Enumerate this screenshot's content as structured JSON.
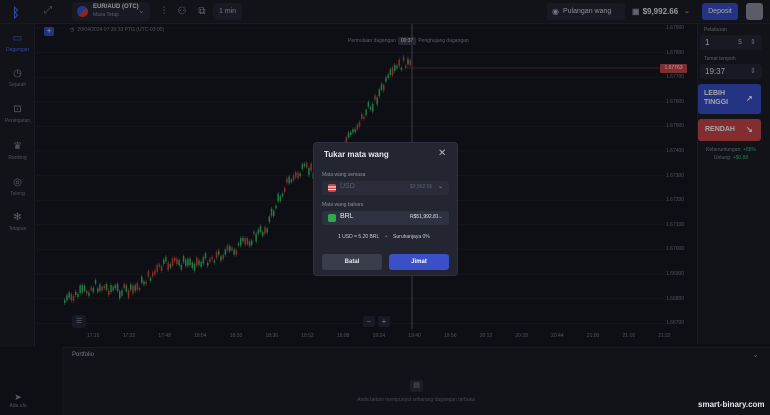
{
  "topbar": {
    "asset_name": "EUR/AUD (OTC)",
    "asset_sub": "Masa Tetap",
    "timeframe": "1 min",
    "switch_account": "Pulangan wang tunai",
    "balance": "$9,992.66",
    "deposit": "Deposit"
  },
  "sidebar": {
    "items": [
      {
        "label": "Dagangan",
        "icon": "trading-icon"
      },
      {
        "label": "Sejarah",
        "icon": "history-icon"
      },
      {
        "label": "Peningatan",
        "icon": "gift-icon"
      },
      {
        "label": "Ranking",
        "icon": "trophy-icon"
      },
      {
        "label": "Tolong",
        "icon": "help-icon"
      },
      {
        "label": "Tetapan",
        "icon": "settings-icon"
      }
    ],
    "chat": "Ada ulu"
  },
  "chart": {
    "datetime": "20/04/2024 07:35:33 PTG (UTC-03:00)",
    "start_text": "Permulaan dagangan",
    "start_tag": "00:37",
    "end_text": "Penghujung dagangan",
    "current_price": "1.67763",
    "price_labels": [
      "1.67900",
      "1.67800",
      "1.67700",
      "1.67600",
      "1.67500",
      "1.67400",
      "1.67300",
      "1.67200",
      "1.67100",
      "1.67000",
      "1.66900",
      "1.66800",
      "1.66700"
    ],
    "time_labels": [
      "17:16",
      "17:32",
      "17:48",
      "18:04",
      "18:20",
      "18:36",
      "18:52",
      "19:08",
      "19:24",
      "19:40",
      "19:56",
      "20:12",
      "20:28",
      "20:44",
      "21:00",
      "21:16",
      "21:32"
    ],
    "zoom_minus": "−",
    "zoom_plus": "+"
  },
  "right_panel": {
    "amount_label": "Pelaburan",
    "amount_value": "1",
    "expiry_label": "Tamat tempoh",
    "expiry_value": "19:37",
    "up_line1": "LEBIH",
    "up_line2": "TINGGI",
    "down": "RENDAH",
    "profit_label": "Keberuntungan: ",
    "profit_pct": "+88%",
    "profit_value_label": "Untung: ",
    "profit_value": "+$0.88"
  },
  "portfolio": {
    "title": "Portfolio",
    "empty_text": "Anda belum mempunyai sebarang dagangan terbuka"
  },
  "modal": {
    "title": "Tukar mata wang",
    "current_label": "Mata wang semasa",
    "current_code": "USD",
    "current_amount": "$9,992.66",
    "new_label": "Mata wang baharu",
    "new_code": "BRL",
    "new_amount": "R$51,992.81",
    "rate": "1 USD = 5.20 BRL",
    "commission": "Suruhanjaya 0%",
    "cancel": "Batal",
    "confirm": "Jimat"
  },
  "watermark": "smart-binary.com",
  "colors": {
    "accent": "#3a50c8",
    "down": "#c8484c",
    "up_candle": "#3dbb6a",
    "down_candle": "#d64a40"
  }
}
